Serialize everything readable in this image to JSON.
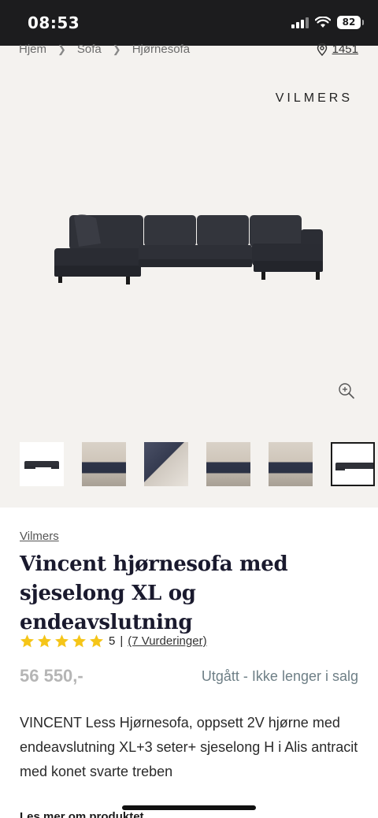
{
  "status_bar": {
    "time": "08:53",
    "battery": "82"
  },
  "breadcrumb": {
    "items": [
      "Hjem",
      "Sofa",
      "Hjørnesofa"
    ]
  },
  "store": {
    "number": "1451"
  },
  "gallery": {
    "brand_logo": "VILMERS",
    "thumbnail_count": 6,
    "selected_index": 5
  },
  "product": {
    "brand": "Vilmers",
    "title": "Vincent hjørnesofa med sjeselong XL og endeavslutning",
    "rating_value": "5",
    "rating_separator": "|",
    "reviews_label": "(7 Vurderinger)",
    "stars": 5,
    "price": "56 550,-",
    "availability": "Utgått - Ikke lenger i salg",
    "description": "VINCENT Less Hjørnesofa, oppsett 2V hjørne med endeavslutning XL+3 seter+ sjeselong H i Alis antracit med konet svarte treben",
    "read_more": "Les mer om produktet"
  },
  "colors": {
    "star": "#f5c518",
    "title": "#1a1a2e",
    "price": "#b5b5b5",
    "availability": "#6e7f86",
    "gallery_bg": "#f4f2ef"
  }
}
